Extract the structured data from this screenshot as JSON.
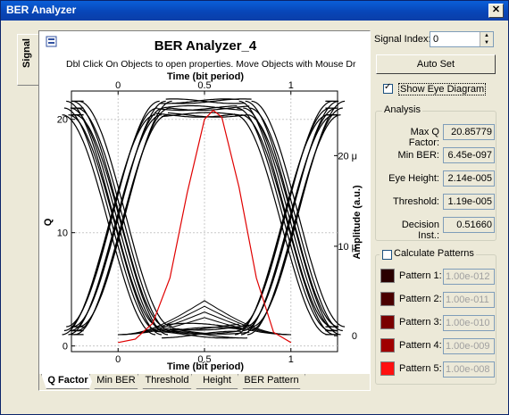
{
  "window": {
    "title": "BER Analyzer",
    "close_glyph": "✕"
  },
  "side_tab": {
    "label": "Signal"
  },
  "plot": {
    "title": "BER Analyzer_4",
    "subtitle": "Dbl Click On Objects to open properties.  Move Objects with Mouse Dr",
    "top_axis_label": "Time (bit period)",
    "bottom_axis_label": "Time (bit period)",
    "left_axis_label": "Q",
    "right_axis_label": "Amplitude (a.u.)",
    "x_ticks": [
      "0",
      "0.5",
      "1"
    ],
    "q_ticks": [
      "0",
      "10",
      "20"
    ],
    "amp_ticks": [
      "0",
      "10 μ",
      "20 μ"
    ]
  },
  "chart_data": {
    "type": "line",
    "title": "BER Analyzer_4",
    "xlabel": "Time (bit period)",
    "ylabel": "Q",
    "y2label": "Amplitude (a.u.)",
    "xlim": [
      -0.27,
      1.27
    ],
    "ylim": [
      -0.5,
      22.5
    ],
    "series": [
      {
        "x": [
          0.0,
          0.1,
          0.2,
          0.3,
          0.4,
          0.5,
          0.55,
          0.6,
          0.7,
          0.8,
          0.9,
          1.0
        ],
        "y": [
          0.3,
          0.6,
          2.0,
          6.0,
          13.5,
          20.0,
          20.8,
          20.2,
          14.0,
          6.0,
          1.2,
          0.3
        ]
      }
    ]
  },
  "bottom_tabs": [
    {
      "label": "Q Factor"
    },
    {
      "label": "Min BER"
    },
    {
      "label": "Threshold"
    },
    {
      "label": "Height"
    },
    {
      "label": "BER Pattern"
    }
  ],
  "controls": {
    "signal_index_label": "Signal Index:",
    "signal_index_value": "0",
    "auto_set_label": "Auto Set",
    "show_eye_label": "Show Eye Diagram",
    "show_eye_checked": true
  },
  "analysis": {
    "legend": "Analysis",
    "rows": [
      {
        "label": "Max Q Factor:",
        "value": "20.85779"
      },
      {
        "label": "Min BER:",
        "value": "6.45e-097"
      },
      {
        "label": "Eye Height:",
        "value": "2.14e-005"
      },
      {
        "label": "Threshold:",
        "value": "1.19e-005"
      },
      {
        "label": "Decision Inst.:",
        "value": "0.51660"
      }
    ]
  },
  "patterns": {
    "legend": "Calculate Patterns",
    "checked": false,
    "rows": [
      {
        "label": "Pattern 1:",
        "value": "1.00e-012",
        "color": "#2a0000"
      },
      {
        "label": "Pattern 2:",
        "value": "1.00e-011",
        "color": "#4a0000"
      },
      {
        "label": "Pattern 3:",
        "value": "1.00e-010",
        "color": "#7a0000"
      },
      {
        "label": "Pattern 4:",
        "value": "1.00e-009",
        "color": "#a00000"
      },
      {
        "label": "Pattern 5:",
        "value": "1.00e-008",
        "color": "#ff1010"
      }
    ]
  }
}
